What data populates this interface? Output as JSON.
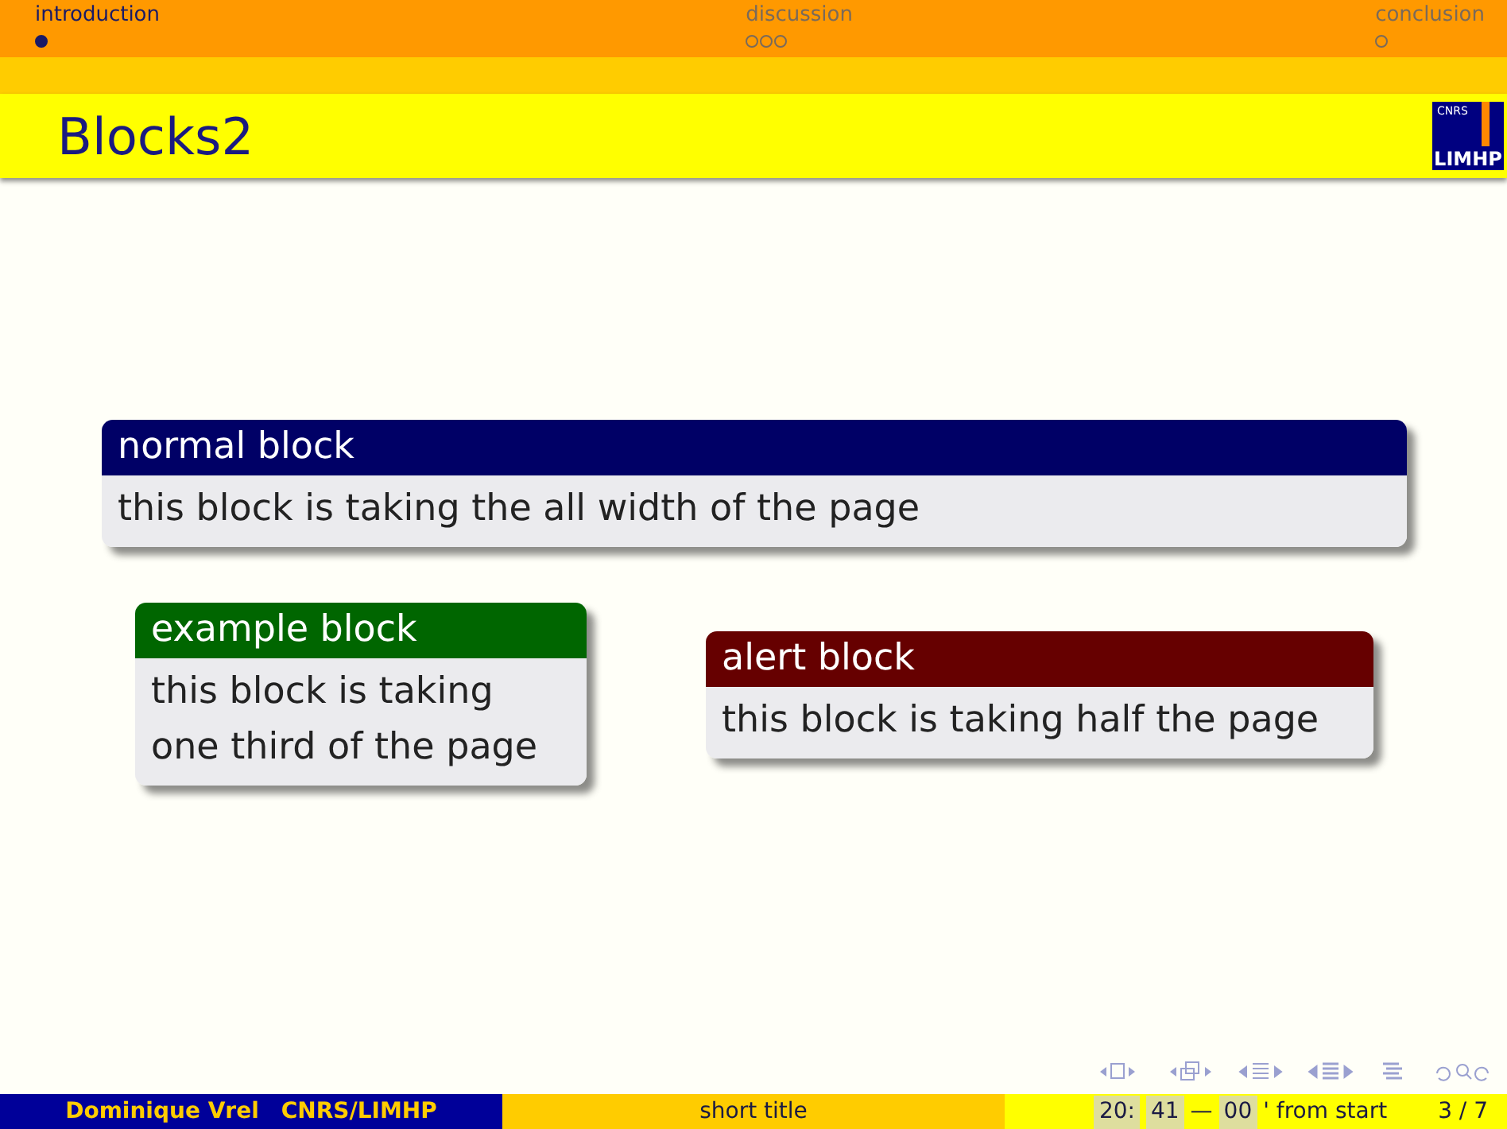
{
  "sections": [
    {
      "label": "introduction",
      "selected": true,
      "frames": [
        {
          "current": true
        }
      ]
    },
    {
      "label": "discussion",
      "selected": false,
      "frames": [
        {
          "current": false
        },
        {
          "current": false
        },
        {
          "current": false
        }
      ]
    },
    {
      "label": "conclusion",
      "selected": false,
      "frames": [
        {
          "current": false
        }
      ]
    }
  ],
  "frame_title": "Blocks2",
  "logo": {
    "top": "CNRS",
    "bottom": "LIMHP"
  },
  "blocks": [
    {
      "kind": "normal",
      "title": "normal block",
      "body": "this block is taking the all width of the page"
    },
    {
      "kind": "example",
      "title": "example block",
      "body": "this block is taking one third of the page"
    },
    {
      "kind": "alert",
      "title": "alert block",
      "body": "this block is taking half the page"
    }
  ],
  "footer": {
    "author": "Dominique Vrel",
    "institute": "CNRS/LIMHP",
    "short_title": "short title",
    "clock_hours": "20",
    "clock_sep": ":",
    "clock_minutes": "41",
    "dash": "—",
    "elapsed": "00",
    "elapsed_label": "' from start",
    "page": "3 / 7"
  }
}
